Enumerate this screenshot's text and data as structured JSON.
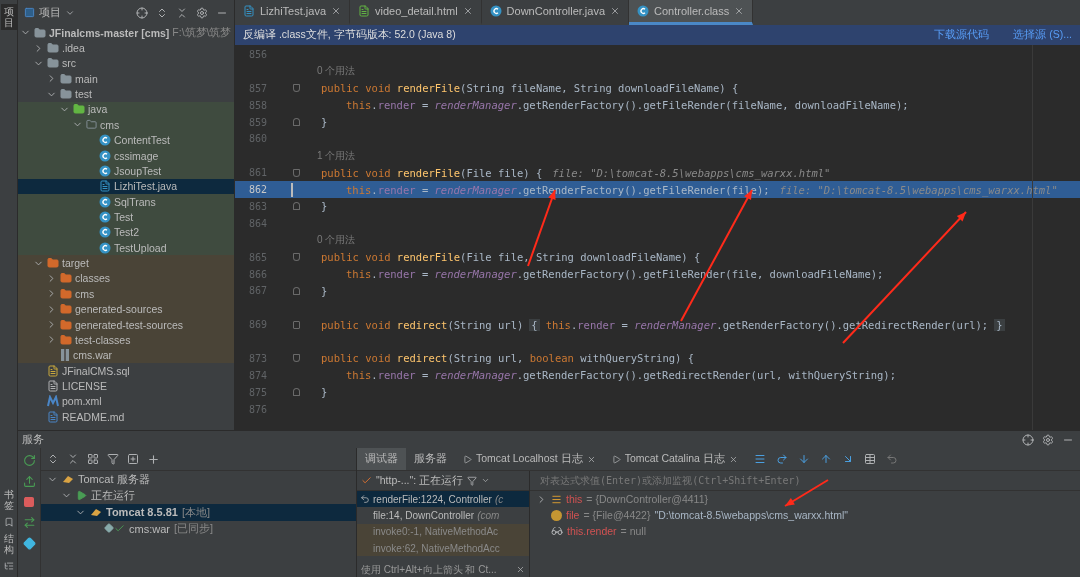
{
  "side_strip": {
    "top": "项目",
    "bottom": [
      "书签",
      "结构"
    ]
  },
  "project": {
    "title": "项目",
    "tree": [
      {
        "label": "JFinalcms-master",
        "module": "[cms]",
        "path": "F:\\筑梦\\筑梦",
        "kind": "module",
        "expanded": true,
        "selected": false,
        "children": [
          {
            "label": ".idea",
            "kind": "folder",
            "expanded": false,
            "selected": false
          },
          {
            "label": "src",
            "kind": "folder",
            "expanded": true,
            "selected": false,
            "children": [
              {
                "label": "main",
                "kind": "folder",
                "expanded": false,
                "selected": false
              },
              {
                "label": "test",
                "kind": "folder",
                "expanded": true,
                "selected": false,
                "children": [
                  {
                    "label": "java",
                    "kind": "test-source",
                    "expanded": true,
                    "selected": false,
                    "children": [
                      {
                        "label": "cms",
                        "kind": "package",
                        "expanded": true,
                        "selected": false,
                        "children": [
                          {
                            "label": "ContentTest",
                            "kind": "class",
                            "selected": false
                          },
                          {
                            "label": "cssimage",
                            "kind": "class",
                            "selected": false
                          },
                          {
                            "label": "JsoupTest",
                            "kind": "class",
                            "selected": false
                          },
                          {
                            "label": "LizhiTest.java",
                            "kind": "java",
                            "selected": true
                          },
                          {
                            "label": "SqlTrans",
                            "kind": "class",
                            "selected": false
                          },
                          {
                            "label": "Test",
                            "kind": "class",
                            "selected": false
                          },
                          {
                            "label": "Test2",
                            "kind": "class",
                            "selected": false
                          },
                          {
                            "label": "TestUpload",
                            "kind": "class",
                            "selected": false
                          }
                        ]
                      }
                    ]
                  }
                ]
              }
            ]
          },
          {
            "label": "target",
            "kind": "excluded",
            "expanded": true,
            "selected": false,
            "children": [
              {
                "label": "classes",
                "kind": "excluded",
                "expanded": false,
                "selected": false
              },
              {
                "label": "cms",
                "kind": "excluded",
                "expanded": false,
                "selected": false
              },
              {
                "label": "generated-sources",
                "kind": "excluded",
                "expanded": false,
                "selected": false
              },
              {
                "label": "generated-test-sources",
                "kind": "excluded",
                "expanded": false,
                "selected": false
              },
              {
                "label": "test-classes",
                "kind": "excluded",
                "expanded": false,
                "selected": false
              },
              {
                "label": "cms.war",
                "kind": "archive",
                "selected": false
              }
            ]
          },
          {
            "label": "JFinalCMS.sql",
            "kind": "sql",
            "selected": false
          },
          {
            "label": "LICENSE",
            "kind": "text",
            "selected": false
          },
          {
            "label": "pom.xml",
            "kind": "maven",
            "selected": false
          },
          {
            "label": "README.md",
            "kind": "markdown",
            "selected": false
          }
        ]
      }
    ]
  },
  "editor": {
    "tabs": [
      {
        "label": "LizhiTest.java",
        "kind": "java",
        "selected": false
      },
      {
        "label": "video_detail.html",
        "kind": "html",
        "selected": false
      },
      {
        "label": "DownController.java",
        "kind": "class",
        "selected": false
      },
      {
        "label": "Controller.class",
        "kind": "class",
        "selected": true
      }
    ],
    "banner": {
      "text": "反编译 .class文件, 字节码版本: 52.0 (Java 8)",
      "links": [
        "下载源代码",
        "选择源 (S)..."
      ]
    },
    "lines": [
      {
        "kind": "code",
        "number": "856",
        "current": false
      },
      {
        "kind": "usage",
        "text": "0 个用法"
      },
      {
        "kind": "code",
        "number": "857",
        "fold_start": true,
        "current": false,
        "tokens": [
          {
            "kind": "kw",
            "text": "public void "
          },
          {
            "kind": "fn",
            "text": "renderFile"
          },
          {
            "kind": "plain",
            "text": "(String fileName, String downloadFileName) {"
          }
        ]
      },
      {
        "kind": "code",
        "number": "858",
        "indented": true,
        "current": false,
        "tokens": [
          {
            "kind": "kw",
            "text": "this"
          },
          {
            "kind": "plain",
            "text": "."
          },
          {
            "kind": "field",
            "text": "render"
          },
          {
            "kind": "plain",
            "text": " = "
          },
          {
            "kind": "static",
            "text": "renderManager"
          },
          {
            "kind": "plain",
            "text": ".getRenderFactory().getFileRender(fileName, downloadFileName);"
          }
        ]
      },
      {
        "kind": "code",
        "number": "859",
        "fold_end": true,
        "current": false,
        "tokens": [
          {
            "kind": "plain",
            "text": "}"
          }
        ]
      },
      {
        "kind": "code",
        "number": "860",
        "current": false
      },
      {
        "kind": "usage",
        "text": "1 个用法"
      },
      {
        "kind": "code",
        "number": "861",
        "fold_start": true,
        "current": false,
        "tokens": [
          {
            "kind": "kw",
            "text": "public void "
          },
          {
            "kind": "fn",
            "text": "renderFile"
          },
          {
            "kind": "plain",
            "text": "(File file) {"
          },
          {
            "kind": "hint",
            "text": "file: \"D:\\tomcat-8.5\\webapps\\cms_warxx.html\""
          }
        ]
      },
      {
        "kind": "code",
        "number": "862",
        "indented": true,
        "current": true,
        "tokens": [
          {
            "kind": "kw",
            "text": "this"
          },
          {
            "kind": "plain",
            "text": "."
          },
          {
            "kind": "field",
            "text": "render"
          },
          {
            "kind": "plain",
            "text": " = "
          },
          {
            "kind": "static",
            "text": "renderManager"
          },
          {
            "kind": "plain",
            "text": ".getRenderFactory().getFileRender(file);"
          },
          {
            "kind": "hint",
            "text": "file: \"D:\\tomcat-8.5\\webapps\\cms_warxx.html\""
          }
        ]
      },
      {
        "kind": "code",
        "number": "863",
        "fold_end": true,
        "current": false,
        "tokens": [
          {
            "kind": "plain",
            "text": "}"
          }
        ]
      },
      {
        "kind": "code",
        "number": "864",
        "current": false
      },
      {
        "kind": "usage",
        "text": "0 个用法"
      },
      {
        "kind": "code",
        "number": "865",
        "fold_start": true,
        "current": false,
        "tokens": [
          {
            "kind": "kw",
            "text": "public void "
          },
          {
            "kind": "fn",
            "text": "renderFile"
          },
          {
            "kind": "plain",
            "text": "(File file, String downloadFileName) {"
          }
        ]
      },
      {
        "kind": "code",
        "number": "866",
        "indented": true,
        "current": false,
        "tokens": [
          {
            "kind": "kw",
            "text": "this"
          },
          {
            "kind": "plain",
            "text": "."
          },
          {
            "kind": "field",
            "text": "render"
          },
          {
            "kind": "plain",
            "text": " = "
          },
          {
            "kind": "static",
            "text": "renderManager"
          },
          {
            "kind": "plain",
            "text": ".getRenderFactory().getFileRender(file, downloadFileName);"
          }
        ]
      },
      {
        "kind": "code",
        "number": "867",
        "fold_end": true,
        "current": false,
        "tokens": [
          {
            "kind": "plain",
            "text": "}"
          }
        ]
      },
      {
        "kind": "code",
        "current": false
      },
      {
        "kind": "code",
        "number": "869",
        "folded": true,
        "current": false,
        "tokens": [
          {
            "kind": "kw",
            "text": "public void "
          },
          {
            "kind": "fn",
            "text": "redirect"
          },
          {
            "kind": "plain",
            "text": "(String url)"
          },
          {
            "kind": "folded",
            "text": "{"
          },
          {
            "kind": "kw",
            "text": "this"
          },
          {
            "kind": "plain",
            "text": "."
          },
          {
            "kind": "field",
            "text": "render"
          },
          {
            "kind": "plain",
            "text": " = "
          },
          {
            "kind": "static",
            "text": "renderManager"
          },
          {
            "kind": "plain",
            "text": ".getRenderFactory().getRedirectRender(url);"
          },
          {
            "kind": "folded",
            "text": "}"
          }
        ]
      },
      {
        "kind": "code",
        "current": false
      },
      {
        "kind": "code",
        "number": "873",
        "fold_start": true,
        "current": false,
        "tokens": [
          {
            "kind": "kw",
            "text": "public void "
          },
          {
            "kind": "fn",
            "text": "redirect"
          },
          {
            "kind": "plain",
            "text": "(String url, "
          },
          {
            "kind": "kw",
            "text": "boolean"
          },
          {
            "kind": "plain",
            "text": " withQueryString) {"
          }
        ]
      },
      {
        "kind": "code",
        "number": "874",
        "indented": true,
        "current": false,
        "tokens": [
          {
            "kind": "kw",
            "text": "this"
          },
          {
            "kind": "plain",
            "text": "."
          },
          {
            "kind": "field",
            "text": "render"
          },
          {
            "kind": "plain",
            "text": " = "
          },
          {
            "kind": "static",
            "text": "renderManager"
          },
          {
            "kind": "plain",
            "text": ".getRenderFactory().getRedirectRender(url, withQueryString);"
          }
        ]
      },
      {
        "kind": "code",
        "number": "875",
        "fold_end": true,
        "current": false,
        "tokens": [
          {
            "kind": "plain",
            "text": "}"
          }
        ]
      },
      {
        "kind": "code",
        "number": "876",
        "current": false
      }
    ]
  },
  "services": {
    "title": "服务",
    "tree": [
      {
        "label": "Tomcat 服务器",
        "kind": "server",
        "expanded": true,
        "selected": false,
        "children": [
          {
            "label": "正在运行",
            "kind": "running",
            "expanded": true,
            "selected": false,
            "children": [
              {
                "label": "Tomcat 8.5.81",
                "note": "[本地]",
                "kind": "tomcat",
                "expanded": true,
                "selected": true,
                "children": [
                  {
                    "label": "cms:war",
                    "note": "[已同步]",
                    "kind": "artifact",
                    "selected": false
                  }
                ]
              }
            ]
          }
        ]
      }
    ]
  },
  "debugger": {
    "tabs": [
      {
        "label": "调试器",
        "kind": "plain",
        "selected": true
      },
      {
        "label": "服务器",
        "kind": "plain",
        "selected": false
      },
      {
        "label": "Tomcat Localhost 日志",
        "kind": "log",
        "selected": false
      },
      {
        "label": "Tomcat Catalina 日志",
        "kind": "log",
        "selected": false
      }
    ],
    "thread": "\"http-...\": 正在运行",
    "frames": [
      {
        "label": "renderFile:1224, Controller",
        "detail": "(c",
        "selected": true,
        "kind": "current"
      },
      {
        "label": "file:14, DownController",
        "detail": "(com",
        "selected": false,
        "kind": "frame"
      },
      {
        "label": "invoke0:-1, NativeMethodAc",
        "selected": false,
        "kind": "library"
      },
      {
        "label": "invoke:62, NativeMethodAcc",
        "selected": false,
        "kind": "library"
      }
    ],
    "tip": "使用 Ctrl+Alt+向上箭头 和 Ct...",
    "eval_placeholder": "对表达式求值(Enter)或添加监视(Ctrl+Shift+Enter)",
    "variables": [
      {
        "name": "this",
        "value": "= {DownController@4411}",
        "kind": "object",
        "expanded": false
      },
      {
        "name": "file",
        "value": "= {File@4422}",
        "string": "\"D:\\tomcat-8.5\\webapps\\cms_warxx.html\"",
        "kind": "field"
      },
      {
        "name": "this.render",
        "value": "= null",
        "kind": "watch"
      }
    ]
  }
}
